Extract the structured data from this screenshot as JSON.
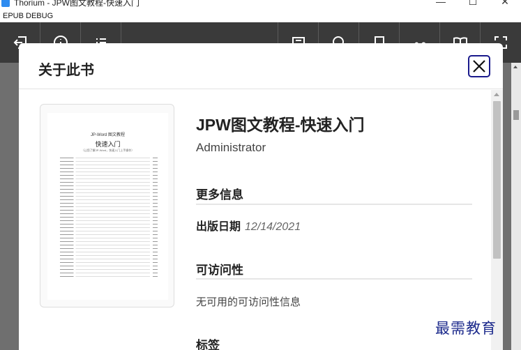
{
  "window": {
    "title": "Thorium - JPW图文教程-快速入门",
    "controls": {
      "minimize": "—",
      "maximize": "☐",
      "close": "✕"
    }
  },
  "menubar": {
    "label": "EPUB DEBUG"
  },
  "toolbar": {
    "left_icons": [
      "back-to-library-icon",
      "info-icon",
      "toc-icon"
    ],
    "right_icons": [
      "fullscreen-reader-icon",
      "search-icon",
      "bookmark-icon",
      "text-settings-icon",
      "reading-mode-icon",
      "fullscreen-icon"
    ]
  },
  "modal": {
    "title": "关于此书",
    "close_icon": "close-icon"
  },
  "cover": {
    "brand": "JP-Word 图文教程",
    "title": "快速入门",
    "subtitle": "（让您了解JP-Word，快速入门上手操作）"
  },
  "book": {
    "title": "JPW图文教程-快速入门",
    "author": "Administrator",
    "more_info_heading": "更多信息",
    "published_label": "出版日期",
    "published_value": "12/14/2021",
    "accessibility_heading": "可访问性",
    "accessibility_text": "无可用的可访问性信息",
    "tags_heading": "标签"
  },
  "watermark": "最需教育",
  "colors": {
    "toolbar_bg": "#3a3a3a",
    "close_border": "#1a1a8c",
    "watermark": "#1c2a8c",
    "overlay": "#6f6f6f"
  }
}
